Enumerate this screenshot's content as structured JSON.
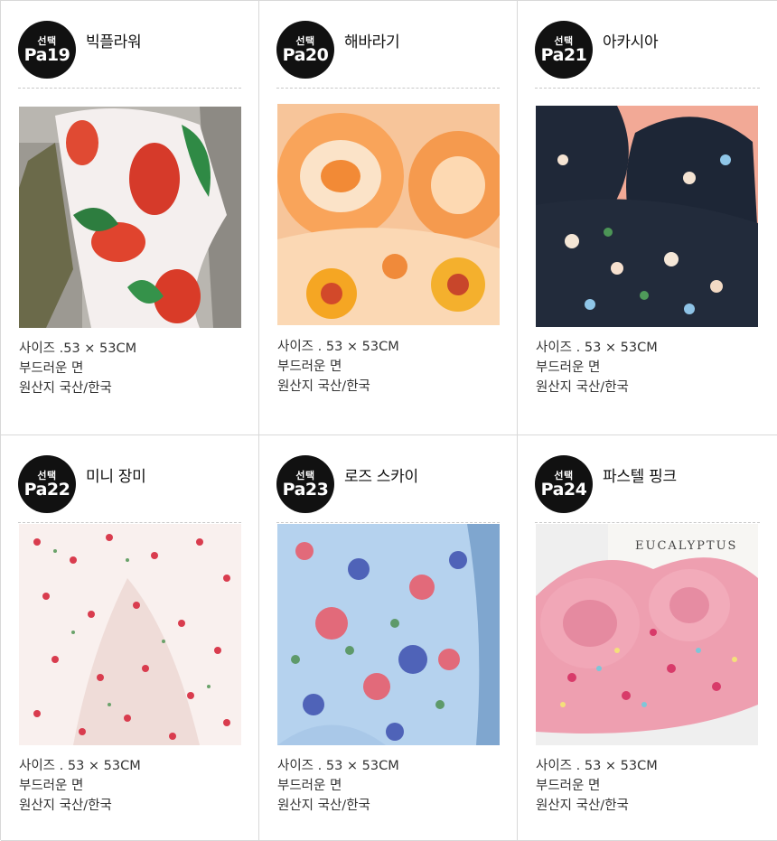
{
  "products": [
    {
      "badge_top": "선택",
      "code": "Pa19",
      "name": "빅플라워",
      "size": "사이즈 .53 × 53CM",
      "material": "부드러운 면",
      "origin": "원산지 국산/한국"
    },
    {
      "badge_top": "선택",
      "code": "Pa20",
      "name": "해바라기",
      "size": "사이즈 . 53 × 53CM",
      "material": "부드러운 면",
      "origin": "원산지 국산/한국"
    },
    {
      "badge_top": "선택",
      "code": "Pa21",
      "name": "아카시아",
      "size": "사이즈 . 53 × 53CM",
      "material": "부드러운 면",
      "origin": "원산지 국산/한국"
    },
    {
      "badge_top": "선택",
      "code": "Pa22",
      "name": "미니 장미",
      "size": "사이즈 . 53 × 53CM",
      "material": "부드러운 면",
      "origin": "원산지 국산/한국"
    },
    {
      "badge_top": "선택",
      "code": "Pa23",
      "name": "로즈 스카이",
      "size": "사이즈 . 53 × 53CM",
      "material": "부드러운 면",
      "origin": "원산지 국산/한국"
    },
    {
      "badge_top": "선택",
      "code": "Pa24",
      "name": "파스텔 핑크",
      "size": "사이즈 . 53 × 53CM",
      "material": "부드러운 면",
      "origin": "원산지 국산/한국"
    }
  ],
  "photo_text": {
    "book_title": "EUCALYPTUS"
  }
}
